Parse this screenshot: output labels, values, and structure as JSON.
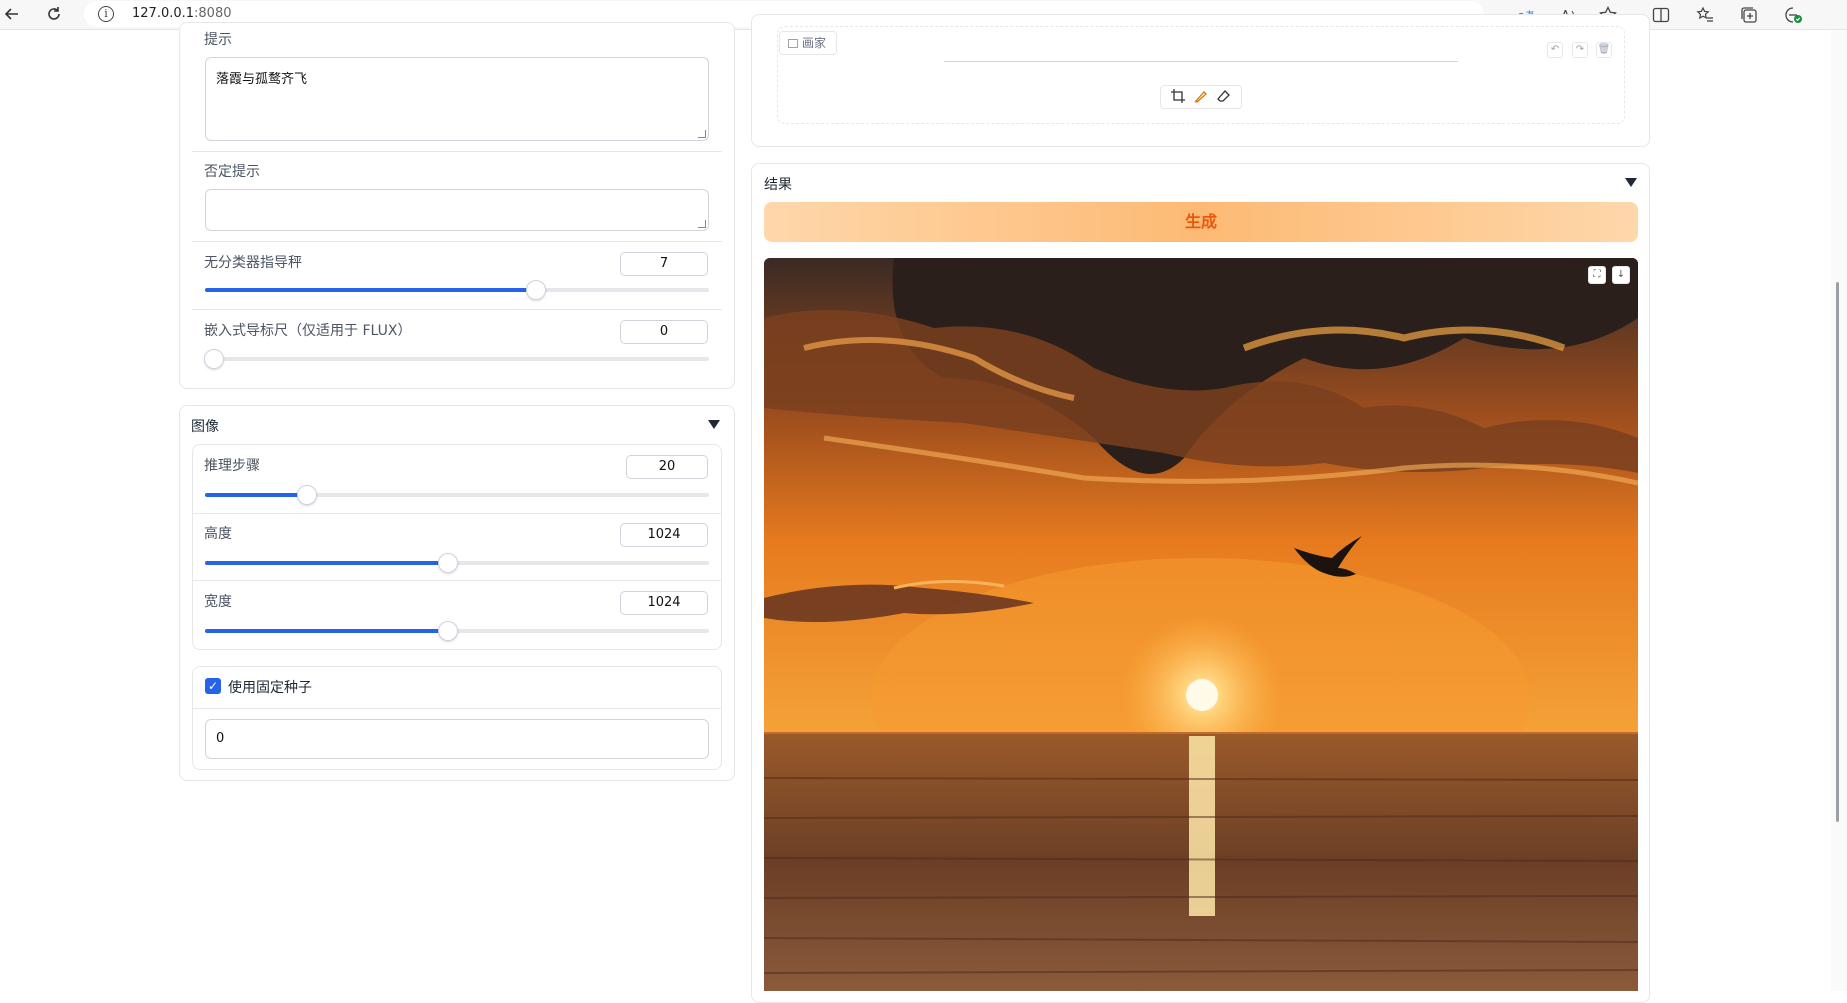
{
  "browser": {
    "url_host": "127.0.0.1",
    "url_port": ":8080"
  },
  "prompt": {
    "label": "提示",
    "value": "落霞与孤鹜齐飞"
  },
  "negative_prompt": {
    "label": "否定提示",
    "value": ""
  },
  "cfg_scale": {
    "label": "无分类器指导秤",
    "value": "7",
    "fraction": 0.65
  },
  "embedded_guidance": {
    "label": "嵌入式导标尺（仅适用于 FLUX）",
    "value": "0",
    "fraction": 0.0
  },
  "image_section": {
    "title": "图像",
    "steps": {
      "label": "推理步骤",
      "value": "20",
      "fraction": 0.2
    },
    "height": {
      "label": "高度",
      "value": "1024",
      "fraction": 0.48
    },
    "width": {
      "label": "宽度",
      "value": "1024",
      "fraction": 0.48
    }
  },
  "seed": {
    "checkbox_label": "使用固定种子",
    "checked": true,
    "value": "0"
  },
  "sketch_editor": {
    "tab_label": "画家"
  },
  "results": {
    "title": "结果",
    "generate_label": "生成"
  },
  "colors": {
    "accent": "#2563eb",
    "generate_text": "#ea580c"
  }
}
